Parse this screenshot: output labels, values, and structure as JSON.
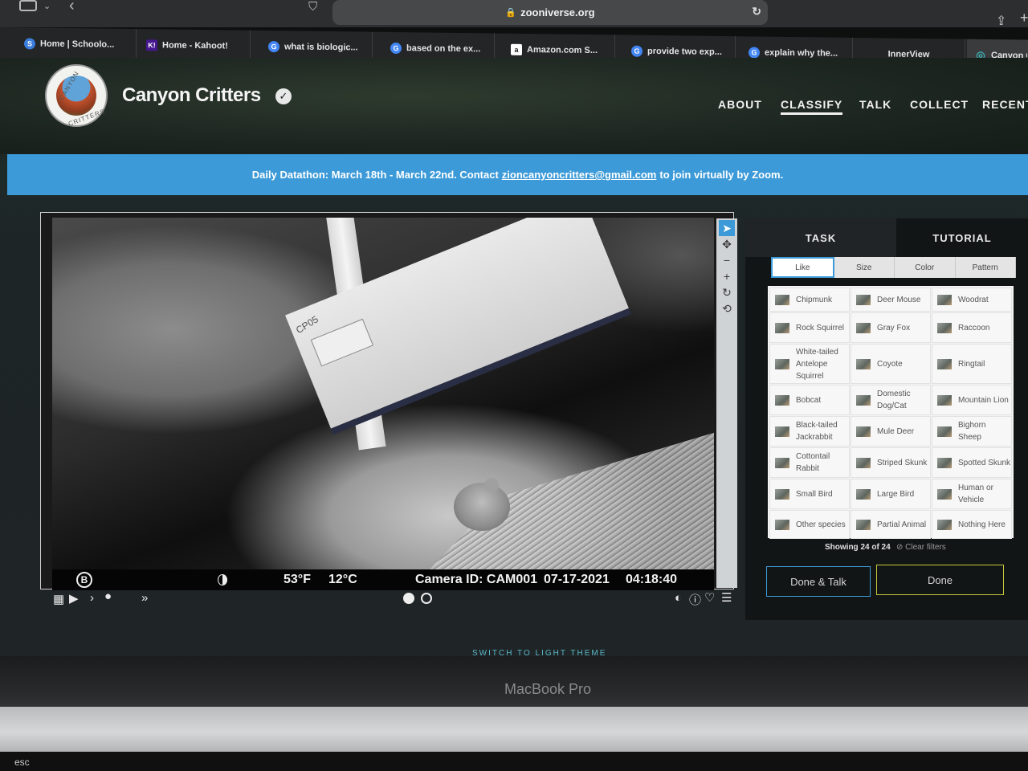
{
  "browser": {
    "url": "zooniverse.org",
    "tabs": [
      {
        "label": "Home | Schoolo...",
        "fav_color": "#3b7ddd",
        "fav": "S"
      },
      {
        "label": "Home - Kahoot!",
        "fav_color": "#46178f",
        "fav": "K!"
      },
      {
        "label": "what is biologic...",
        "fav_color": "#4285f4",
        "fav": "G"
      },
      {
        "label": "based on the ex...",
        "fav_color": "#4285f4",
        "fav": "G"
      },
      {
        "label": "Amazon.com S...",
        "fav_color": "#ffffff",
        "fav": "a"
      },
      {
        "label": "provide two exp...",
        "fav_color": "#4285f4",
        "fav": "G"
      },
      {
        "label": "explain why the...",
        "fav_color": "#4285f4",
        "fav": "G"
      },
      {
        "label": "InnerView",
        "fav_color": "",
        "fav": ""
      },
      {
        "label": "Canyon C",
        "fav_color": "#3ab0b0",
        "fav": "◎"
      }
    ]
  },
  "site": {
    "title": "Canyon Critters",
    "logo_top": "CANYON",
    "logo_bottom": "CRITTERS",
    "nav": [
      "ABOUT",
      "CLASSIFY",
      "TALK",
      "COLLECT",
      "RECENT"
    ],
    "active_nav": "CLASSIFY",
    "banner": {
      "before": "Daily Datathon: March 18th - March 22nd. Contact",
      "email": "zioncanyoncritters@gmail.com",
      "after": "to join virtually by Zoom."
    }
  },
  "camera": {
    "brand": "B",
    "temp_f": "53°F",
    "temp_c": "12°C",
    "camera_id": "Camera ID: CAM001",
    "date": "07-17-2021",
    "time": "04:18:40",
    "board_code": "CP05"
  },
  "task": {
    "tabs": [
      "TASK",
      "TUTORIAL"
    ],
    "filters": [
      "Like",
      "Size",
      "Color",
      "Pattern"
    ],
    "species": [
      "Chipmunk",
      "Deer Mouse",
      "Woodrat",
      "Rock Squirrel",
      "Gray Fox",
      "Raccoon",
      "White-tailed Antelope Squirrel",
      "Coyote",
      "Ringtail",
      "Bobcat",
      "Domestic Dog/Cat",
      "Mountain Lion",
      "Black-tailed Jackrabbit",
      "Mule Deer",
      "Bighorn Sheep",
      "Cottontail Rabbit",
      "Striped Skunk",
      "Spotted Skunk",
      "Small Bird",
      "Large Bird",
      "Human or Vehicle",
      "Other species",
      "Partial Animal",
      "Nothing Here"
    ],
    "showing": "Showing 24 of 24",
    "clear_filters": "Clear filters",
    "done_talk": "Done & Talk",
    "done": "Done"
  },
  "footer": {
    "light_theme": "SWITCH TO LIGHT THEME"
  },
  "laptop": {
    "model": "MacBook Pro",
    "esc": "esc"
  }
}
